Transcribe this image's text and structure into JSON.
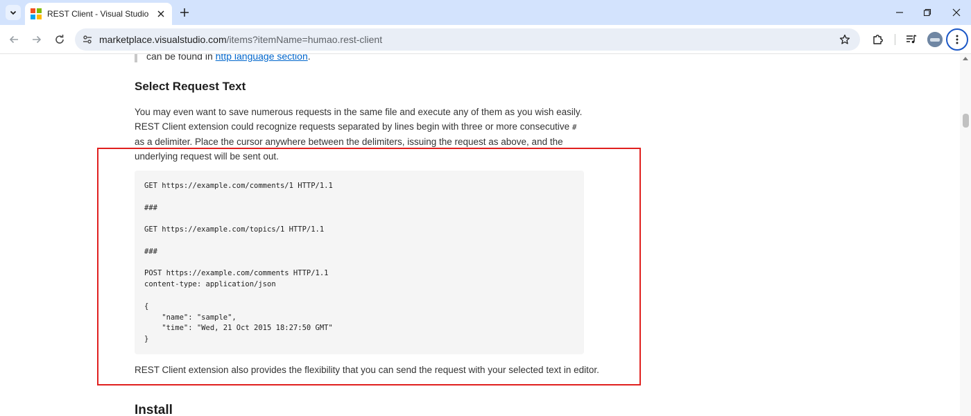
{
  "browser": {
    "tab": {
      "title": "REST Client - Visual Studio Marketplace",
      "favicon_colors": [
        "#f25022",
        "#7fba00",
        "#00a4ef",
        "#ffb900"
      ]
    },
    "address": {
      "host": "marketplace.visualstudio.com",
      "path": "/items?itemName=humao.rest-client"
    },
    "accent_color": "#1a56c6",
    "tabstrip_color": "#d3e3fd"
  },
  "page": {
    "quote": {
      "prefix": "can be found in ",
      "link": "http language section",
      "suffix": "."
    },
    "section_title": "Select Request Text",
    "paragraph": {
      "part1": "You may even want to save numerous requests in the same file and execute any of them as you wish easily. REST Client extension could recognize requests separated by lines begin with three or more consecutive ",
      "code": "#",
      "part2": " as a delimiter. Place the cursor anywhere between the delimiters, issuing the request as above, and the underlying request will be sent out."
    },
    "code_block": "GET https://example.com/comments/1 HTTP/1.1\n\n###\n\nGET https://example.com/topics/1 HTTP/1.1\n\n###\n\nPOST https://example.com/comments HTTP/1.1\ncontent-type: application/json\n\n{\n    \"name\": \"sample\",\n    \"time\": \"Wed, 21 Oct 2015 18:27:50 GMT\"\n}",
    "paragraph2": "REST Client extension also provides the flexibility that you can send the request with your selected text in editor.",
    "next_section_title": "Install",
    "highlight_color": "#e0201e"
  }
}
